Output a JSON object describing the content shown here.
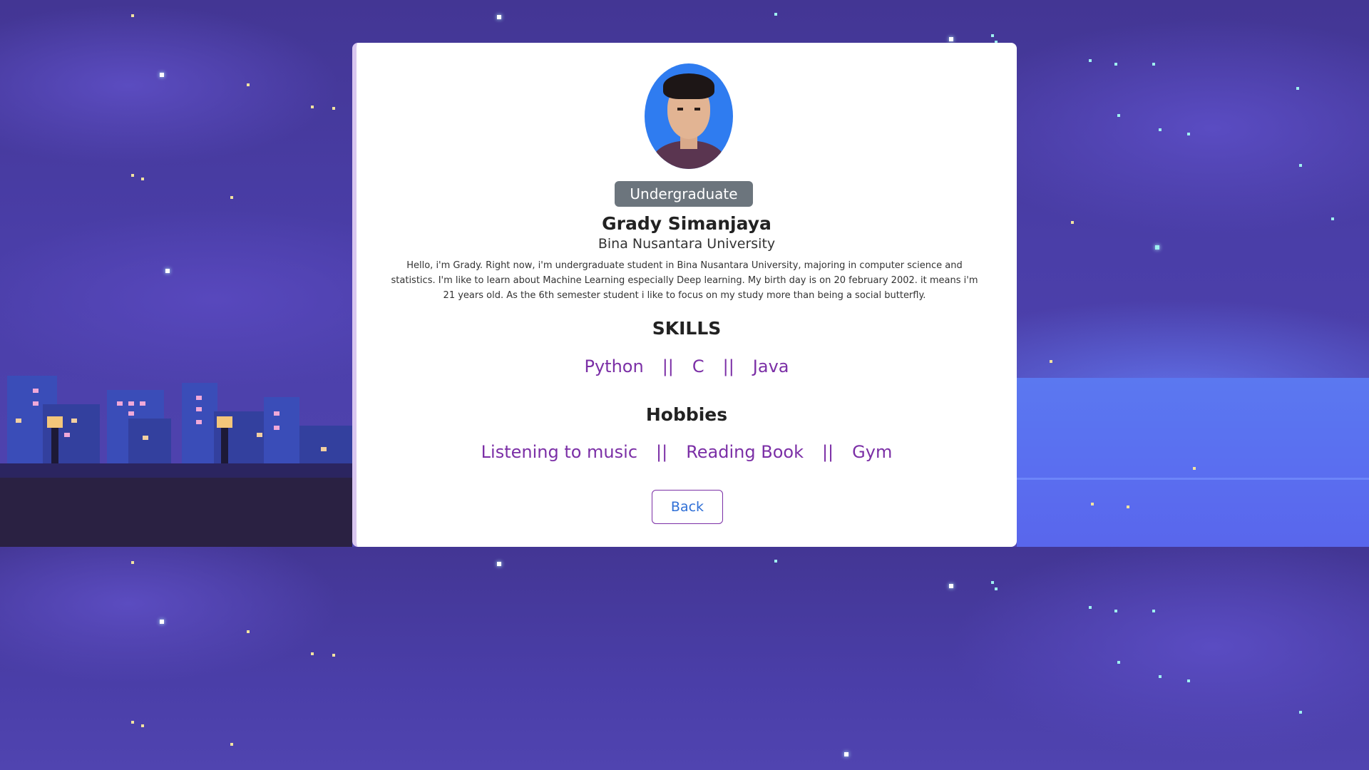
{
  "profile": {
    "status_badge": "Undergraduate",
    "name": "Grady Simanjaya",
    "university": "Bina Nusantara University",
    "bio": "Hello, i'm Grady. Right now, i'm undergraduate student in Bina Nusantara University, majoring in computer science and statistics. I'm like to learn about Machine Learning especially Deep learning. My birth day is on 20 february 2002. it means i'm 21 years old. As the 6th semester student i like to focus on my study more than being a social butterfly."
  },
  "skills": {
    "heading": "SKILLS",
    "items": [
      "Python",
      "C",
      "Java"
    ],
    "separator": "||"
  },
  "hobbies": {
    "heading": "Hobbies",
    "items": [
      "Listening to music",
      "Reading Book",
      "Gym"
    ],
    "separator": "||"
  },
  "actions": {
    "back_label": "Back"
  },
  "colors": {
    "accent_purple": "#7b2fa6",
    "badge_gray": "#6c757d",
    "link_blue": "#2f6fd6",
    "background_night": "#4b3ea6"
  },
  "icons": {
    "avatar": "profile-photo"
  }
}
